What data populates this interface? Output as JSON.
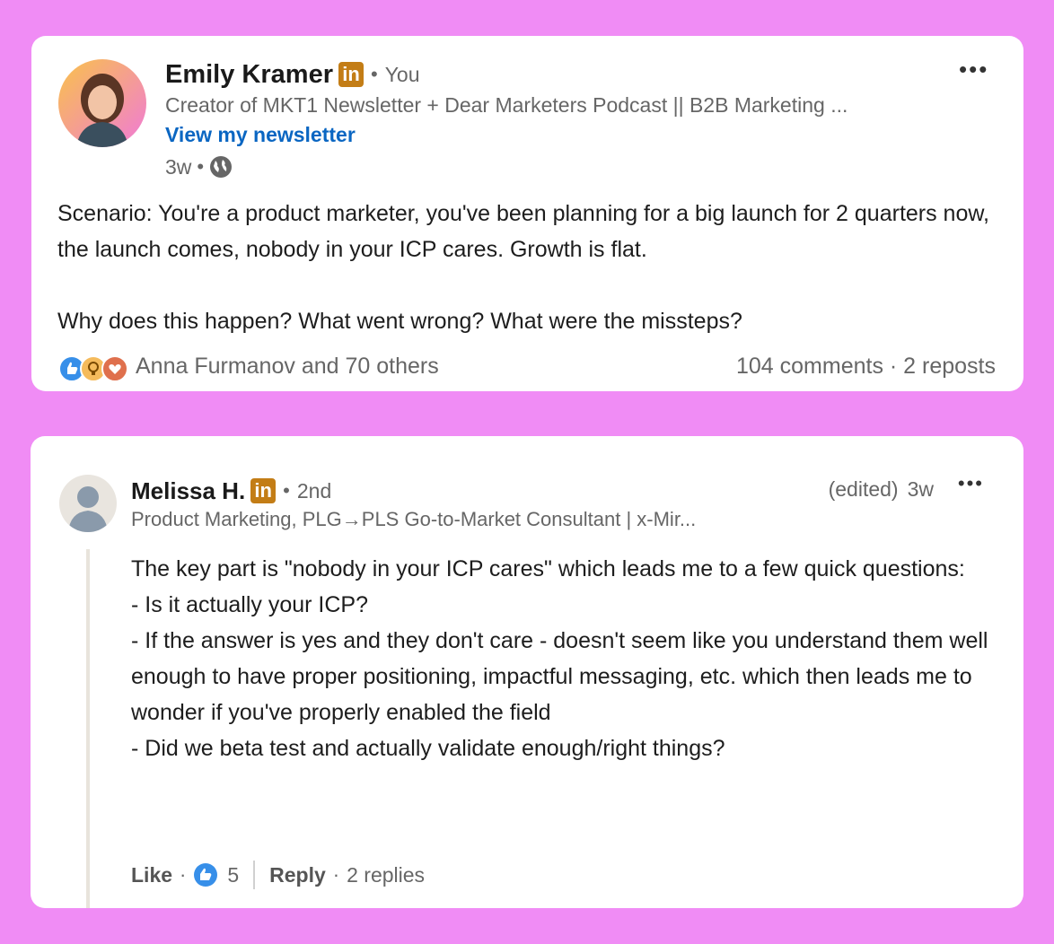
{
  "post": {
    "author": "Emily Kramer",
    "badge": "in",
    "relation": "You",
    "headline": "Creator of MKT1 Newsletter + Dear Marketers Podcast || B2B Marketing ...",
    "link_label": "View my newsletter",
    "time": "3w",
    "visibility_icon": "globe-icon",
    "paragraphs": [
      "Scenario: You're a product marketer, you've been planning for a big launch for 2 quarters now, the launch comes, nobody in your ICP cares. Growth is flat.",
      "Why does this happen? What went wrong? What were the missteps?"
    ],
    "reactions_label": "Anna Furmanov and 70 others",
    "counts_label": "104 comments · 2 reposts",
    "reaction_icons": [
      "like-icon",
      "insightful-icon",
      "love-icon"
    ]
  },
  "comment": {
    "author": "Melissa H.",
    "badge": "in",
    "relation": "2nd",
    "headline": "Product Marketing, PLG→PLS Go-to-Market Consultant | x-Mir...",
    "edited": "(edited)",
    "time": "3w",
    "lines": [
      "The key part is \"nobody in your ICP cares\" which leads me to a few quick questions:",
      "- Is it actually your ICP?",
      "- If the answer is yes and they don't care - doesn't seem like you understand them well enough to have proper positioning, impactful messaging, etc. which then leads me to wonder if you've properly enabled the field",
      "- Did we beta test and actually validate enough/right things?"
    ],
    "like_label": "Like",
    "like_count": "5",
    "reply_label": "Reply",
    "replies_label": "2 replies"
  },
  "colors": {
    "background": "#f08cf5",
    "link": "#0a66c2",
    "linkedin_badge": "#c37d16"
  }
}
